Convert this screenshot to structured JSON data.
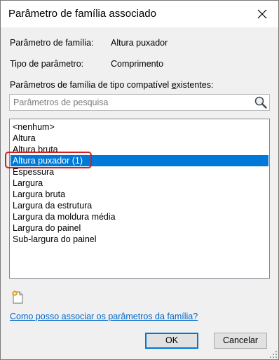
{
  "dialog": {
    "title": "Parâmetro de família associado",
    "close_icon": "close-icon"
  },
  "family_parameter": {
    "label": "Parâmetro de família:",
    "value": "Altura puxador"
  },
  "parameter_type": {
    "label": "Tipo de parâmetro:",
    "value": "Comprimento"
  },
  "compatible": {
    "label_pre": "Parâmetros de família de tipo compatível ",
    "label_accel": "e",
    "label_post": "xistentes:"
  },
  "search": {
    "placeholder": "Parâmetros de pesquisa",
    "value": "",
    "icon": "search-icon"
  },
  "list": {
    "items": [
      {
        "label": "<nenhum>",
        "selected": false
      },
      {
        "label": "Altura",
        "selected": false
      },
      {
        "label": "Altura bruta",
        "selected": false
      },
      {
        "label": "Altura puxador (1)",
        "selected": true
      },
      {
        "label": "Espessura",
        "selected": false
      },
      {
        "label": "Largura",
        "selected": false
      },
      {
        "label": "Largura bruta",
        "selected": false
      },
      {
        "label": "Largura da estrutura",
        "selected": false
      },
      {
        "label": "Largura da moldura média",
        "selected": false
      },
      {
        "label": "Largura do painel",
        "selected": false
      },
      {
        "label": "Sub-largura do painel",
        "selected": false
      }
    ]
  },
  "new_parameter_icon": "new-parameter-icon",
  "help_link": "Como posso associar os parâmetros da família?",
  "buttons": {
    "ok": "OK",
    "cancel": "Cancelar"
  },
  "colors": {
    "selection": "#0078d7",
    "highlight_ring": "#d21f1f",
    "link": "#0066cc"
  }
}
